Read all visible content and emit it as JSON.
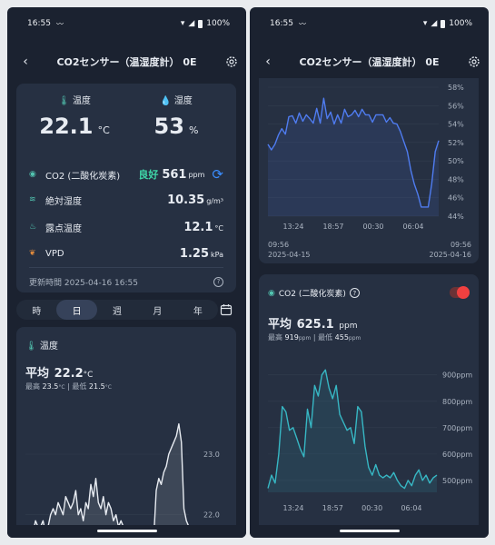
{
  "status": {
    "time": "16:55",
    "battery": "100%"
  },
  "appbar": {
    "back_glyph": "‹",
    "title": "CO2センサー（温湿度計） 0E"
  },
  "summary": {
    "temp_label": "温度",
    "temp_value": "22.1",
    "temp_unit": "°C",
    "humidity_label": "湿度",
    "humidity_value": "53",
    "humidity_unit": "%",
    "co2_label": "CO2 (二酸化炭素)",
    "co2_status": "良好",
    "co2_value": "561",
    "co2_unit": "ppm",
    "abs_humidity_label": "絶対湿度",
    "abs_humidity_value": "10.35",
    "abs_humidity_unit": "g/m³",
    "dew_label": "露点温度",
    "dew_value": "12.1",
    "dew_unit": "°C",
    "vpd_label": "VPD",
    "vpd_value": "1.25",
    "vpd_unit": "kPa",
    "updated": "更新時間 2025-04-16 16:55",
    "help_glyph": "?"
  },
  "tabs": [
    {
      "label": "時",
      "active": false
    },
    {
      "label": "日",
      "active": true
    },
    {
      "label": "週",
      "active": false
    },
    {
      "label": "月",
      "active": false
    },
    {
      "label": "年",
      "active": false
    }
  ],
  "temp_chart_card": {
    "label": "温度",
    "avg_label": "平均",
    "avg_value": "22.2",
    "avg_unit": "°C",
    "max_label": "最高",
    "max_value": "23.5",
    "max_unit": "°C",
    "min_label": "最低",
    "min_value": "21.5",
    "min_unit": "°C",
    "separator": "|"
  },
  "humidity_chart_card": {
    "start_time": "09:56",
    "start_date": "2025-04-15",
    "end_time": "09:56",
    "end_date": "2025-04-16"
  },
  "co2_card": {
    "label": "CO2 (二酸化炭素)",
    "help_glyph": "?",
    "avg_label": "平均",
    "avg_value": "625.1",
    "avg_unit": "ppm",
    "max_label": "最高",
    "max_value": "919",
    "max_unit": "ppm",
    "min_label": "最低",
    "min_value": "455",
    "min_unit": "ppm",
    "separator": "|",
    "toggle_on": true
  },
  "colors": {
    "background": "#1b2230",
    "card": "#263042",
    "teal": "#52c4b0",
    "good": "#3fd6a8",
    "blue_line": "#4f7cf0",
    "cyan_line": "#37b7c4",
    "toggle": "#f04040",
    "refresh": "#3a8dff"
  },
  "chart_data": [
    {
      "type": "line",
      "ylabel": "",
      "ytick_labels": [
        "22.0",
        "23.0"
      ],
      "ylim": [
        21.5,
        23.6
      ],
      "x": [
        0,
        1,
        2,
        3,
        4,
        5,
        6,
        7,
        8,
        9,
        10,
        11,
        12,
        13,
        14,
        15,
        16,
        17,
        18,
        19,
        20,
        21,
        22,
        23,
        24,
        25,
        26,
        27,
        28,
        29,
        30,
        31,
        32,
        33,
        34,
        35,
        36,
        37,
        38,
        39,
        40,
        41,
        42,
        43,
        44,
        45,
        46,
        47,
        48,
        49,
        50,
        51,
        52,
        53,
        54,
        55,
        56,
        57,
        58,
        59,
        60,
        61,
        62,
        63,
        64,
        65
      ],
      "y": [
        21.7,
        21.8,
        21.8,
        21.7,
        21.9,
        21.8,
        21.8,
        21.9,
        21.7,
        21.8,
        22.0,
        22.1,
        22.0,
        22.2,
        22.1,
        22.0,
        22.3,
        22.2,
        22.1,
        22.2,
        22.4,
        22.0,
        22.1,
        21.9,
        22.2,
        22.1,
        22.5,
        22.3,
        22.6,
        22.2,
        22.1,
        22.3,
        22.0,
        22.2,
        22.1,
        21.9,
        22.0,
        21.8,
        21.9,
        21.8,
        21.7,
        21.7,
        21.6,
        21.5,
        21.5,
        21.5,
        21.5,
        21.5,
        21.5,
        21.5,
        21.5,
        21.6,
        22.4,
        22.6,
        22.5,
        22.7,
        22.8,
        23.0,
        23.1,
        23.2,
        23.3,
        23.5,
        23.2,
        22.1,
        21.9,
        21.8
      ],
      "series": [
        {
          "name": ""
        }
      ]
    },
    {
      "type": "line",
      "ytick_labels": [
        "44%",
        "46%",
        "48%",
        "50%",
        "52%",
        "54%",
        "56%",
        "58%"
      ],
      "ylim": [
        44,
        58
      ],
      "xtick_labels": [
        "13:24",
        "18:57",
        "00:30",
        "06:04"
      ],
      "x": [
        0,
        1,
        2,
        3,
        4,
        5,
        6,
        7,
        8,
        9,
        10,
        11,
        12,
        13,
        14,
        15,
        16,
        17,
        18,
        19,
        20,
        21,
        22,
        23,
        24,
        25,
        26,
        27,
        28,
        29,
        30,
        31,
        32,
        33,
        34,
        35,
        36,
        37,
        38,
        39,
        40,
        41,
        42,
        43,
        44,
        45,
        46,
        47,
        48,
        49
      ],
      "y": [
        51.8,
        51.2,
        51.8,
        52.8,
        53.5,
        52.9,
        54.8,
        54.9,
        54.1,
        55.2,
        54.3,
        55.0,
        54.6,
        54.1,
        55.7,
        54.1,
        56.8,
        54.6,
        55.3,
        54.0,
        55.0,
        54.1,
        55.6,
        54.8,
        55.0,
        55.5,
        54.8,
        55.6,
        55.0,
        55.0,
        54.2,
        55.0,
        55.0,
        55.0,
        54.2,
        54.7,
        54.1,
        54.0,
        53.2,
        52.1,
        51.0,
        49.0,
        47.5,
        46.4,
        45.0,
        45.0,
        45.0,
        47.5,
        51.0,
        52.2
      ],
      "series": [
        {
          "name": ""
        }
      ]
    },
    {
      "type": "line",
      "ytick_labels": [
        "500ppm",
        "600ppm",
        "700ppm",
        "800ppm",
        "900ppm"
      ],
      "ylim": [
        455,
        930
      ],
      "xtick_labels": [
        "13:24",
        "18:57",
        "00:30",
        "06:04"
      ],
      "x": [
        0,
        1,
        2,
        3,
        4,
        5,
        6,
        7,
        8,
        9,
        10,
        11,
        12,
        13,
        14,
        15,
        16,
        17,
        18,
        19,
        20,
        21,
        22,
        23,
        24,
        25,
        26,
        27,
        28,
        29,
        30,
        31,
        32,
        33,
        34,
        35,
        36,
        37,
        38,
        39,
        40,
        41,
        42,
        43,
        44,
        45,
        46,
        47
      ],
      "y": [
        470,
        520,
        490,
        600,
        780,
        760,
        690,
        700,
        660,
        620,
        590,
        770,
        700,
        860,
        820,
        900,
        919,
        850,
        810,
        860,
        750,
        720,
        690,
        700,
        640,
        780,
        760,
        630,
        550,
        520,
        560,
        520,
        510,
        520,
        510,
        530,
        500,
        480,
        470,
        500,
        480,
        520,
        540,
        500,
        520,
        490,
        510,
        520
      ],
      "series": [
        {
          "name": ""
        }
      ]
    }
  ]
}
